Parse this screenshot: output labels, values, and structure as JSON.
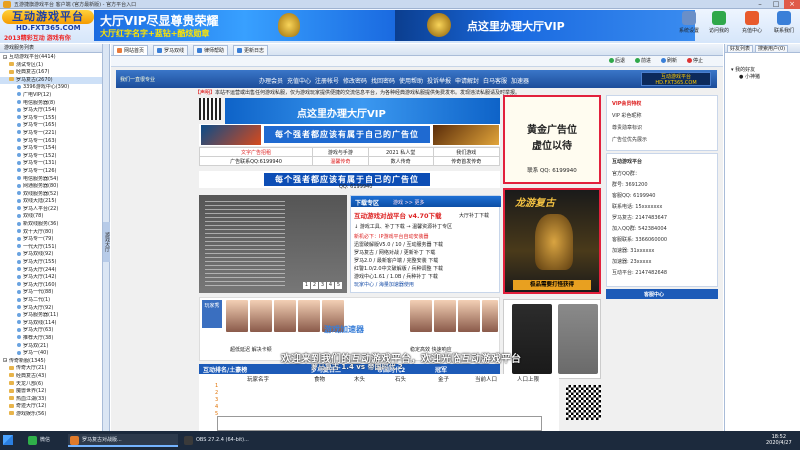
{
  "window": {
    "title": "五游捷旗游戏平台 客户端 (官方最新版) - 官方平台入口"
  },
  "brand": {
    "logo_main": "互动游戏平台",
    "logo_url": "HD.FXT365.COM",
    "logo_slogan": "2013精彩互动 游戏有你"
  },
  "banner": {
    "vip_title": "大厅VIP尽显尊贵荣耀",
    "vip_sub": "大厅红字名字+蓝钻+酷炫勋章",
    "vip_cta": "点这里办理大厅VIP"
  },
  "toolbar": [
    {
      "label": "系统设置",
      "color": "#6a8fc8"
    },
    {
      "label": "访问我的",
      "color": "#2fa84a"
    },
    {
      "label": "充值中心",
      "color": "#e85a2c"
    },
    {
      "label": "联系我们",
      "color": "#3a7fd8"
    }
  ],
  "left_panel": {
    "header": "游戏服务列表",
    "items": [
      {
        "t": "互动游戏平台(4414)",
        "k": "b"
      },
      {
        "t": "测试专区(1)",
        "k": "f"
      },
      {
        "t": "经典复古(167)",
        "k": "f"
      },
      {
        "t": "罗马复古(2670)",
        "k": "f",
        "sel": true
      },
      {
        "t": "3396游戏中心(390)",
        "k": "g"
      },
      {
        "t": "广电VIP(12)",
        "k": "g"
      },
      {
        "t": "电信服务器(8)",
        "k": "g"
      },
      {
        "t": "罗马大厅(154)",
        "k": "g"
      },
      {
        "t": "罗马专一(155)",
        "k": "g"
      },
      {
        "t": "罗马专一(165)",
        "k": "g"
      },
      {
        "t": "罗马专一(221)",
        "k": "g"
      },
      {
        "t": "罗马专一(163)",
        "k": "g"
      },
      {
        "t": "罗马专一(154)",
        "k": "g"
      },
      {
        "t": "罗马专一(152)",
        "k": "g"
      },
      {
        "t": "罗马专一(131)",
        "k": "g"
      },
      {
        "t": "罗马专一(126)",
        "k": "g"
      },
      {
        "t": "电信服务器(54)",
        "k": "g"
      },
      {
        "t": "网通服务器(80)",
        "k": "g"
      },
      {
        "t": "双线服务器(52)",
        "k": "g"
      },
      {
        "t": "双线大陆(215)",
        "k": "g"
      },
      {
        "t": "罗马人平台(22)",
        "k": "g"
      },
      {
        "t": "双线(78)",
        "k": "g"
      },
      {
        "t": "新双线服务(36)",
        "k": "g"
      },
      {
        "t": "双十大厅(80)",
        "k": "g"
      },
      {
        "t": "罗马专一(79)",
        "k": "g"
      },
      {
        "t": "一代大厅(151)",
        "k": "g"
      },
      {
        "t": "罗马双线(92)",
        "k": "g"
      },
      {
        "t": "罗马大厅(155)",
        "k": "g"
      },
      {
        "t": "罗马大厅(244)",
        "k": "g"
      },
      {
        "t": "罗马大厅(142)",
        "k": "g"
      },
      {
        "t": "罗马大厅(160)",
        "k": "g"
      },
      {
        "t": "罗马一代(88)",
        "k": "g"
      },
      {
        "t": "罗马二代(1)",
        "k": "g"
      },
      {
        "t": "罗马大厅(92)",
        "k": "g"
      },
      {
        "t": "罗马服务器(11)",
        "k": "g"
      },
      {
        "t": "罗马双线(114)",
        "k": "g"
      },
      {
        "t": "罗马大厅(63)",
        "k": "g"
      },
      {
        "t": "推荐大厅(38)",
        "k": "g"
      },
      {
        "t": "罗马双(21)",
        "k": "g"
      },
      {
        "t": "罗马一(40)",
        "k": "g"
      },
      {
        "t": "传奇新服(1345)",
        "k": "b"
      },
      {
        "t": "传奇大厅(21)",
        "k": "f"
      },
      {
        "t": "经典复古(43)",
        "k": "f"
      },
      {
        "t": "天龙八部(6)",
        "k": "f"
      },
      {
        "t": "魔兽世界(12)",
        "k": "f"
      },
      {
        "t": "热血江湖(33)",
        "k": "f"
      },
      {
        "t": "奇迹大厅(12)",
        "k": "f"
      },
      {
        "t": "游戏娱乐(56)",
        "k": "f"
      }
    ]
  },
  "vtab": "游戏大厅",
  "tabs": [
    "网站首页",
    "罗马双线",
    "律师帮助",
    "更新日志"
  ],
  "nav": {
    "back": "后退",
    "forward": "前进",
    "refresh": "刷新",
    "stop": "停止"
  },
  "site_nav": {
    "slogan": "我们一直很专业",
    "links": [
      "办理会员",
      "充值中心",
      "注册帐号",
      "修改密码",
      "找回密码",
      "使用帮助",
      "投诉举报",
      "申请解封",
      "白马客服",
      "加速器"
    ],
    "logo": "互动游戏平台 HD.FXT365.COM"
  },
  "notice": {
    "tag": "【声明】",
    "text": "本站不运营或出售任何游戏私服，仅为游戏玩家提供便捷的交流信息平台，为各种经典游戏私服提供免费发布。发现违法私服请及时举报。"
  },
  "center": {
    "vip_ad": "点这里办理大厅VIP",
    "ad_a": "每个强者都应该有属于自己的广告位",
    "ad_b": "每个强者都应该有属于自己的广告位",
    "ad_b_contact": "QQ: 6199940",
    "grid": [
      [
        "文字广告招租",
        "游戏与手游",
        "2021 私人堂",
        "我们游戏"
      ],
      [
        "广告联系QQ:6199940",
        "温馨传奇",
        "数人传奇",
        "传奇首发传奇"
      ]
    ],
    "download": {
      "title": "下载专区",
      "sub": "游戏 >> 更多",
      "headline": "互动游戏对战平台 v4.70下载",
      "headline_right": "大厅补丁下载",
      "lines": [
        "↓ 游戏工具、补丁下载   → 温馨资源补丁专区",
        "新机必下：IP游戏平台自动安装器",
        "迅雷破解版V5.0 / 10 / 互动服务器 下载",
        "罗马复古 / 网络对战 / 更新补丁 下载",
        "罗马2.0 / 最新客户端 / 完整安装 下载",
        "红警1.0/2.0中文破解版 / 兵种调整 下载",
        "游戏中心1.61 / 1.0B / 兵种补丁 下载",
        "玩家中心 / 海量加速器使用"
      ]
    },
    "pager": [
      "1",
      "2",
      "3",
      "4",
      "5"
    ],
    "photo_label": "玩家秀",
    "photo_captions": [
      "超低延迟 解决卡顿",
      "稳定高效 快速响应"
    ],
    "photo_watermark": "游戏加速器",
    "rank_header": [
      "互动排名/土豪榜",
      "罗马复古二",
      "帝国时代2",
      "冠军"
    ],
    "rank_cols": [
      "玩家名字",
      "食物",
      "木头",
      "石头",
      "金子",
      "当前人口",
      "人口上限"
    ],
    "rank_nums": [
      "1",
      "2",
      "3",
      "4",
      "5"
    ]
  },
  "overlay": {
    "line1": "欢迎来到我们的互动游戏平台，欢迎光临互动游戏平台",
    "line2": "罗马复古 1.4 vs 帝国时代 2"
  },
  "right_ads": {
    "gold": {
      "title": "黄金广告位\n虚位以待",
      "contact": "联系 QQ: 6199940"
    },
    "game": {
      "title": "龙游复古",
      "cta": "极品需要打怪获得"
    }
  },
  "side_ad": {
    "vip_title": "VIP会员特权",
    "vip_lines": [
      "VIP  彩色昵称",
      "尊贵勋章标识",
      "广告位优先展示"
    ],
    "info_title": "互动游戏平台",
    "info_lines": [
      "官方QQ群：",
      "群号: 3691200",
      "客服QQ: 6199940",
      "联系电话: 15xxxxxxx",
      "罗马复古: 2147483647",
      "加入QQ群: 542384004",
      "客服联系: 3366060000",
      "加速器: 31xxxxxx",
      "加速器: 23xxxxx",
      "互动平台: 2147482648"
    ],
    "service": "客服中心"
  },
  "right_panel": {
    "tabs": [
      "好友列表",
      "搜索用户(0)"
    ],
    "items": [
      "我的好友",
      "小神猪"
    ]
  },
  "taskbar": {
    "items": [
      {
        "label": "微信",
        "color": "#2fb04a"
      },
      {
        "label": "罗马复古对战版...",
        "color": "#e07a2a"
      },
      {
        "label": "OBS 27.2.4 (64-bit)...",
        "color": "#3a3a3a"
      }
    ],
    "time": "18:52",
    "date": "2020/4/27"
  }
}
